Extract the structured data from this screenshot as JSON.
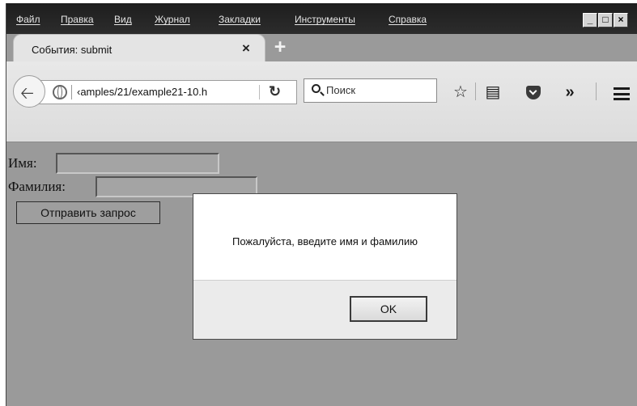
{
  "menu": {
    "items": [
      "Файл",
      "Правка",
      "Вид",
      "Журнал",
      "Закладки",
      "Инструменты",
      "Справка"
    ]
  },
  "window_controls": {
    "minimize": "_",
    "maximize": "□",
    "close": "×"
  },
  "tab": {
    "title": "События: submit",
    "close": "×"
  },
  "newtab": {
    "label": "+"
  },
  "toolbar": {
    "url": "‹amples/21/example21-10.h",
    "reload": "↻",
    "search_placeholder": "Поиск",
    "star": "☆",
    "bookmarks": "▤",
    "overflow": "»"
  },
  "form": {
    "name_label": "Имя:",
    "name_value": "",
    "surname_label": "Фамилия:",
    "surname_value": "",
    "submit_label": "Отправить запрос"
  },
  "dialog": {
    "message": "Пожалуйста, введите имя и фамилию",
    "ok_label": "OK"
  },
  "icons": [
    "back-arrow-icon",
    "globe-icon",
    "reload-icon",
    "search-icon",
    "star-icon",
    "bookmarks-icon",
    "pocket-icon",
    "overflow-icon",
    "hamburger-menu-icon"
  ]
}
